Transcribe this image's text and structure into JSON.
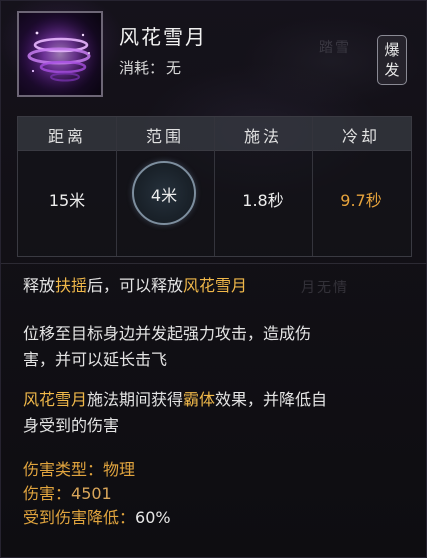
{
  "skill": {
    "name": "风花雪月",
    "cost_label": "消耗：",
    "cost_value": "无",
    "badge": [
      "爆",
      "发"
    ],
    "icon": "purple-whirl-skill-icon"
  },
  "stats": {
    "headers": [
      "距离",
      "范围",
      "施法",
      "冷却"
    ],
    "values": [
      "15米",
      "4米",
      "1.8秒",
      "9.7秒"
    ]
  },
  "description": {
    "line1": {
      "before": "释放",
      "highlight1": "扶摇",
      "middle": "后，可以释放",
      "highlight2": "风花雪月"
    },
    "para2": [
      "位移至目标身边并发起强力攻击，造成伤",
      "害，并可以延长击飞"
    ],
    "para3": {
      "highlight": "风花雪月",
      "text1": "施法期间获得",
      "highlight2": "霸体",
      "text2": "效果，并降低自",
      "line2": "身受到的伤害"
    }
  },
  "attributes": {
    "damage_type_label": "伤害类型：",
    "damage_type_value": "物理",
    "damage_label": "伤害：",
    "damage_value": "4501",
    "reduction_label": "受到伤害降低：",
    "reduction_value": "60%"
  },
  "colors": {
    "highlight": "#f0b84a",
    "cooldown": "#e6a33c",
    "label_orange": "#e0a43e"
  }
}
